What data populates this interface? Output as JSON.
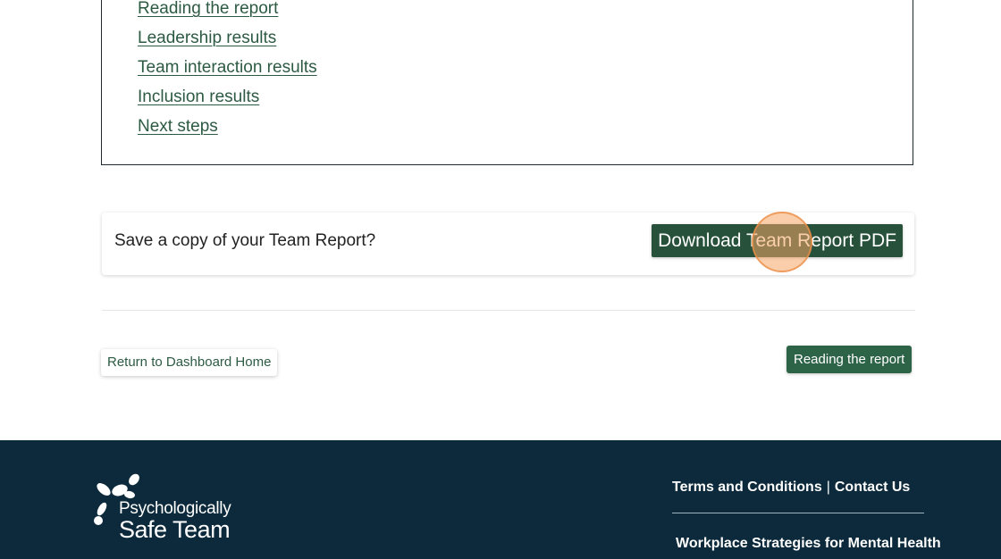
{
  "toc": {
    "items": [
      "Reading the report",
      "Leadership results",
      "Team interaction results",
      "Inclusion results",
      "Next steps"
    ]
  },
  "save_card": {
    "prompt": "Save a copy of your Team Report?",
    "download_label": "Download Team Report PDF"
  },
  "nav": {
    "return_label": "Return to Dashboard Home",
    "next_label": "Reading the report"
  },
  "footer": {
    "logo_line1": "Psychologically",
    "logo_line2": "Safe Team",
    "terms_label": "Terms and Conditions",
    "separator": "|",
    "contact_label": "Contact Us",
    "org_label": "Workplace Strategies for Mental Health"
  },
  "colors": {
    "brand_green": "#27513a",
    "link_green": "#2d5a43",
    "footer_navy": "#0c2a3b",
    "click_highlight": "#f5a564"
  }
}
